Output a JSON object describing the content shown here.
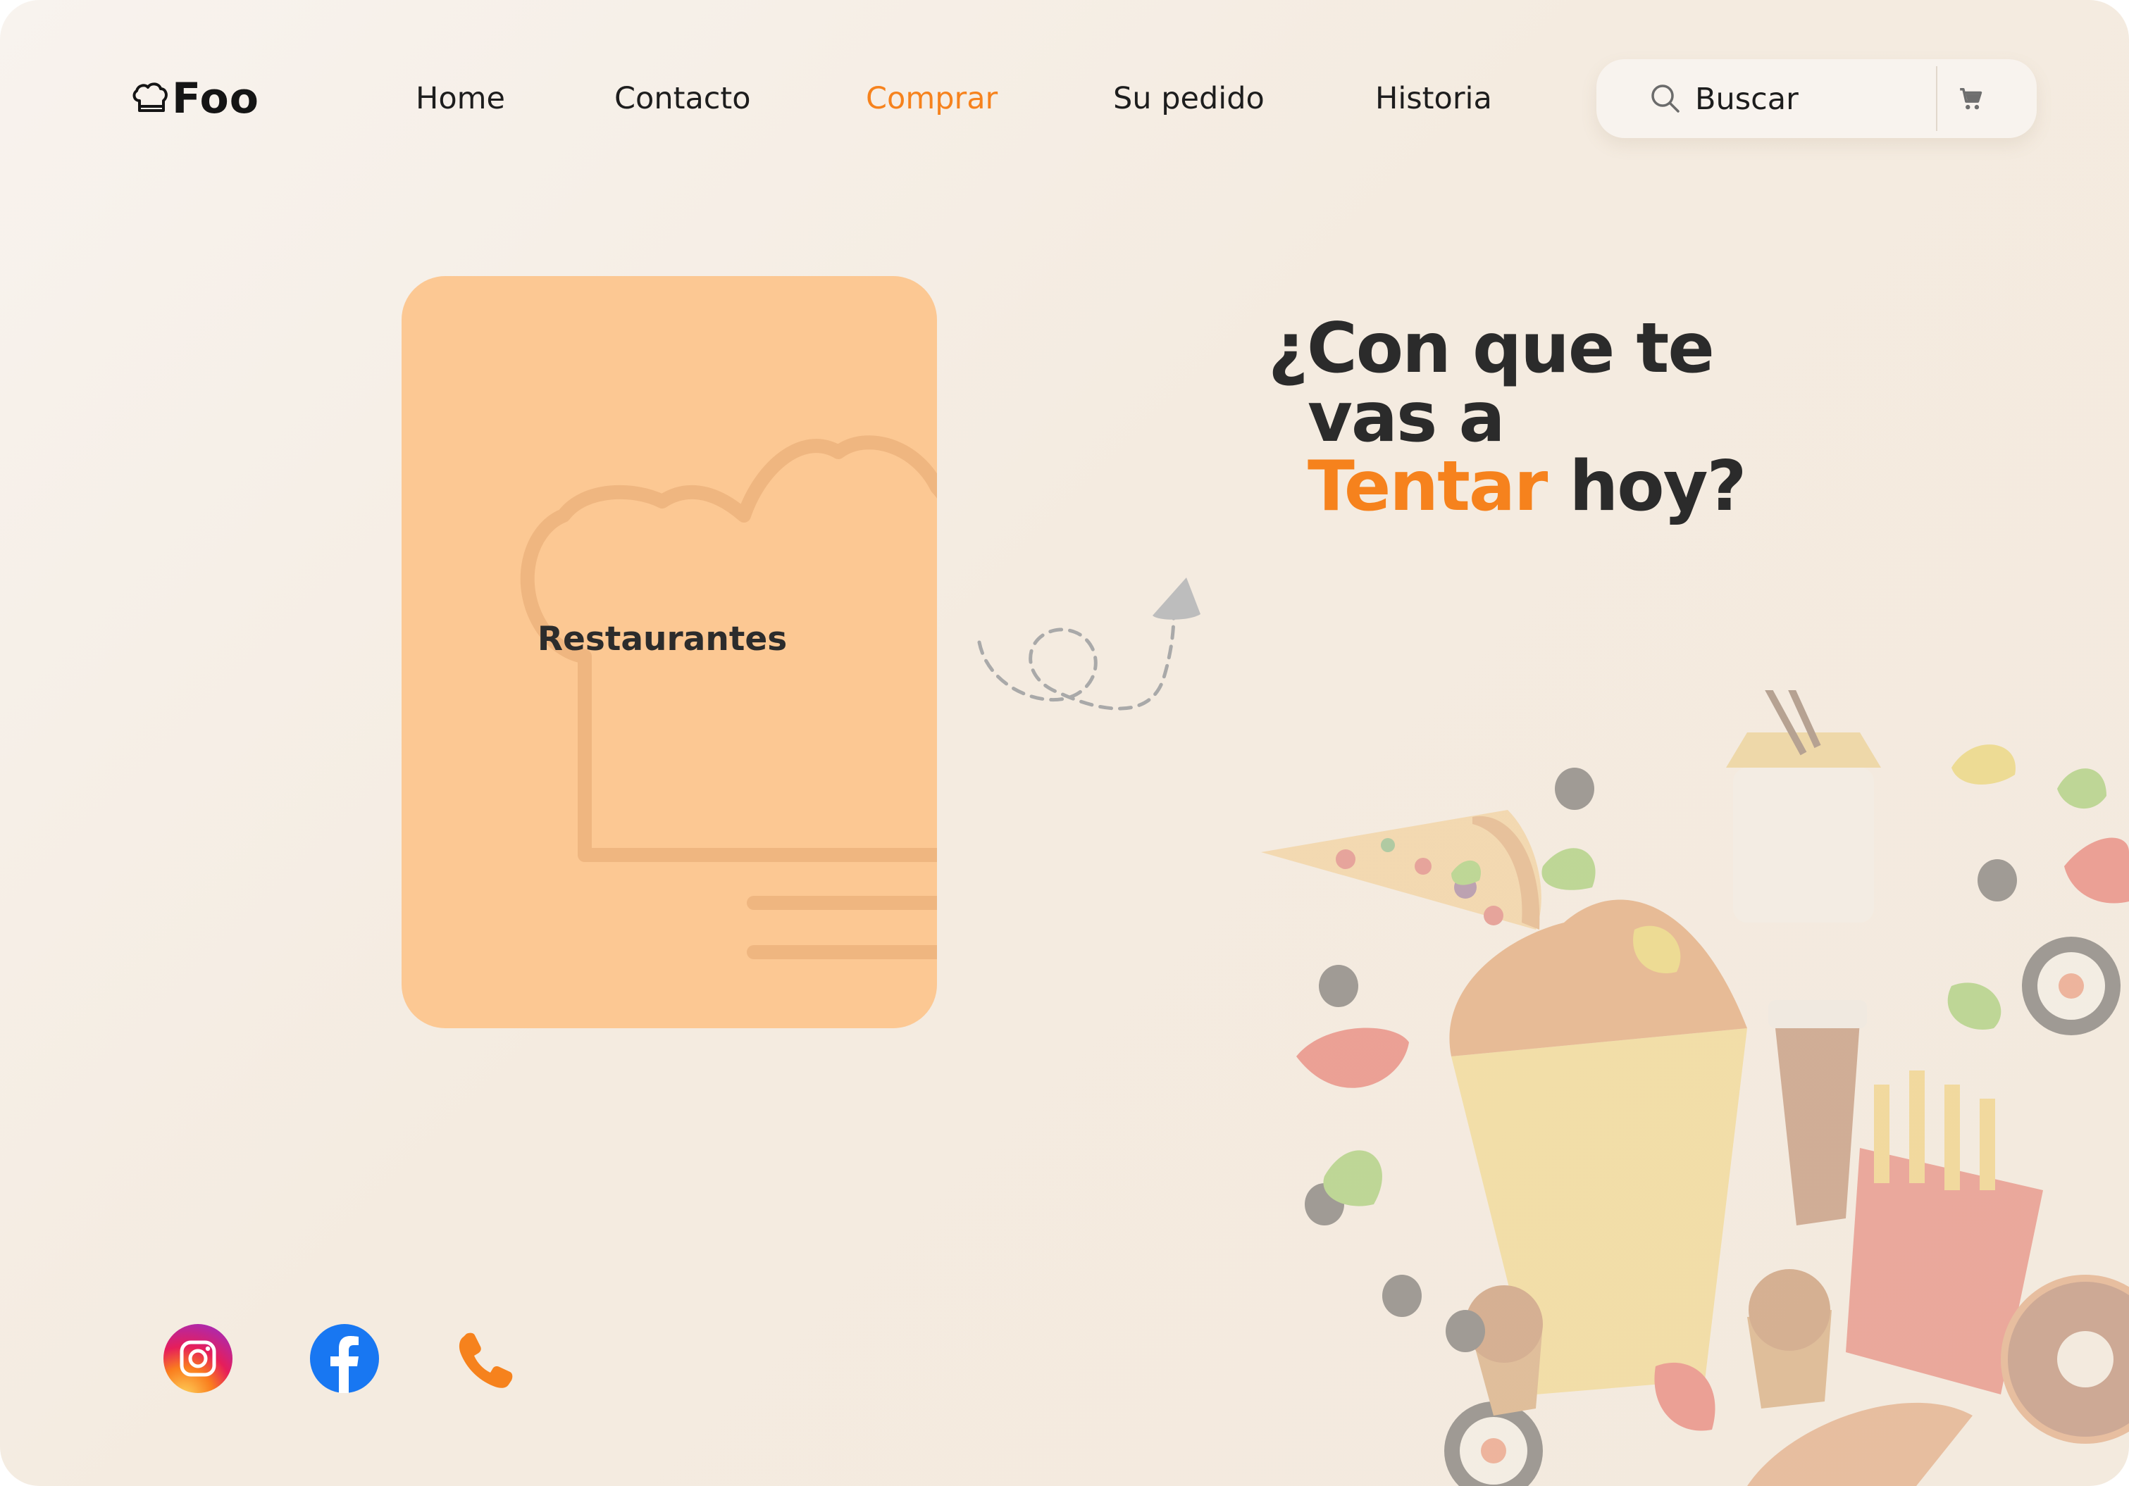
{
  "header": {
    "logo_text": "Foo",
    "logo_icon": "chef-hat-icon",
    "nav": [
      {
        "label": "Home",
        "active": false
      },
      {
        "label": "Contacto",
        "active": false
      },
      {
        "label": "Comprar",
        "active": true
      },
      {
        "label": "Su pedido",
        "active": false
      },
      {
        "label": "Historia",
        "active": false
      }
    ],
    "search": {
      "placeholder": "Buscar",
      "icon": "search-icon"
    },
    "cart_icon": "cart-icon"
  },
  "card": {
    "label": "Restaurantes",
    "watermark_icon": "chef-hat-icon"
  },
  "hero": {
    "line1": "¿Con que te",
    "line2": "vas a",
    "line3_accent": "Tentar",
    "line3_rest": "hoy?"
  },
  "social": [
    {
      "name": "instagram-icon"
    },
    {
      "name": "facebook-icon"
    },
    {
      "name": "phone-icon"
    }
  ],
  "colors": {
    "accent": "#f6821d",
    "card": "#fcc893",
    "text": "#2b2b2b",
    "background": "#f4ebe0"
  }
}
